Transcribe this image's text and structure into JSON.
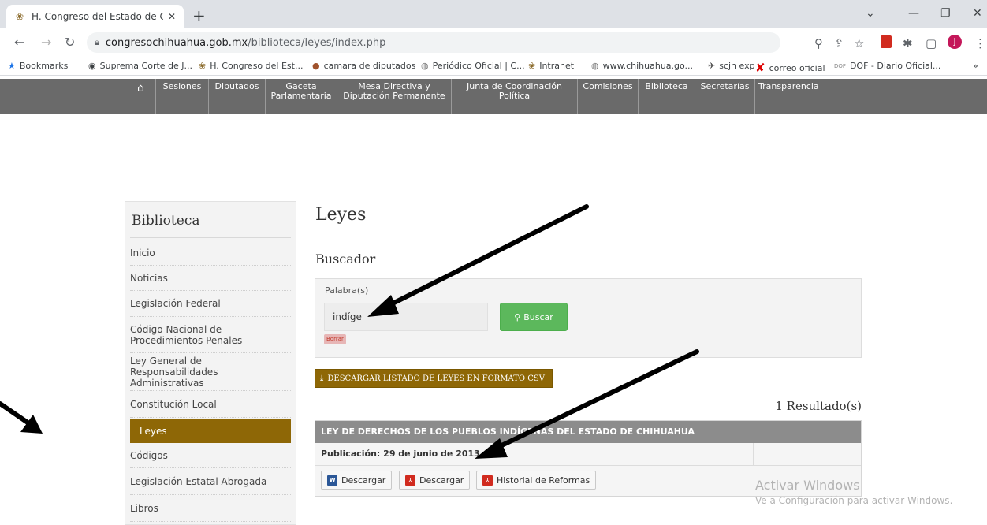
{
  "browser": {
    "tab_title": "H. Congreso del Estado de Chihu",
    "new_tab": "+",
    "address_host": "congresochihuahua.gob.mx",
    "address_path": "/biblioteca/leyes/index.php",
    "profile_initial": "j",
    "bookmarks": [
      {
        "icon": "★",
        "label": "Bookmarks"
      },
      {
        "icon": "◉",
        "label": "Suprema Corte de J..."
      },
      {
        "icon": "❀",
        "label": "H. Congreso del Est..."
      },
      {
        "icon": "●",
        "label": "camara de diputados"
      },
      {
        "icon": "◍",
        "label": "Periódico Oficial | C..."
      },
      {
        "icon": "❀",
        "label": "Intranet"
      },
      {
        "icon": "◍",
        "label": "www.chihuahua.go..."
      },
      {
        "icon": "✈",
        "label": "scjn exp"
      },
      {
        "icon": "✘",
        "label": "correo oficial"
      },
      {
        "icon": "DOF",
        "label": "DOF - Diario Oficial..."
      }
    ],
    "bookmarks_overflow": "»"
  },
  "site_nav": {
    "items": [
      "Sesiones",
      "Diputados",
      "Gaceta\nParlamentaria",
      "Mesa Directiva y\nDiputación Permanente",
      "Junta de Coordinación\nPolítica",
      "Comisiones",
      "Biblioteca",
      "Secretarías",
      "Transparencia"
    ]
  },
  "sidebar": {
    "title": "Biblioteca",
    "items": [
      "Inicio",
      "Noticias",
      "Legislación Federal",
      "Código Nacional de\nProcedimientos Penales",
      "Ley General de Responsabilidades\nAdministrativas",
      "Constitución Local",
      "Leyes",
      "Códigos",
      "Legislación Estatal Abrogada",
      "Libros"
    ],
    "active_index": 6
  },
  "main": {
    "title": "Leyes",
    "search_title": "Buscador",
    "search_label": "Palabra(s)",
    "search_value": "indíge",
    "search_button": "Buscar",
    "clear_button": "Borrar",
    "csv_button": "DESCARGAR LISTADO DE LEYES EN FORMATO CSV",
    "results_count": "1 Resultado(s)",
    "result": {
      "title": "LEY DE DERECHOS DE LOS PUEBLOS INDÍGENAS DEL ESTADO DE CHIHUAHUA",
      "publication": "Publicación: 29 de junio de 2013",
      "word_button": "Descargar",
      "pdf_button": "Descargar",
      "history_button": "Historial de Reformas"
    }
  },
  "watermark": {
    "line1": "Activar Windows",
    "line2": "Ve a Configuración para activar Windows."
  },
  "colors": {
    "accent_gold": "#8e6706",
    "nav_gray": "#6a6a6a",
    "search_green": "#5cb85c"
  }
}
